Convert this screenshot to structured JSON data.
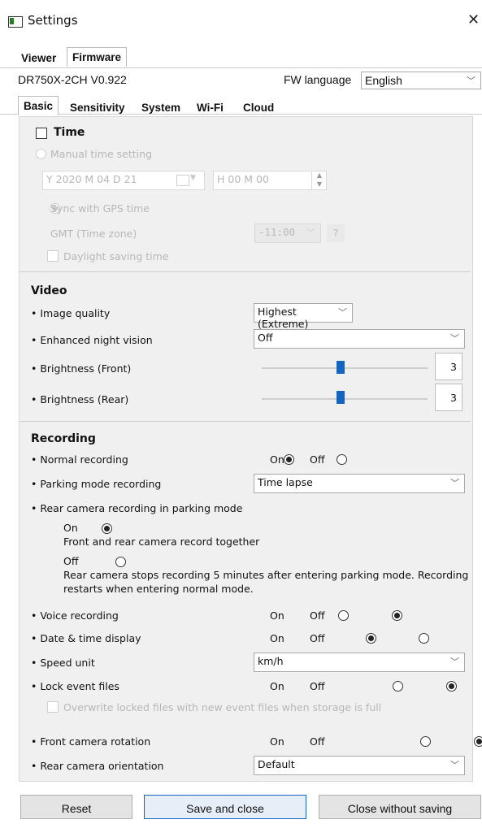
{
  "window": {
    "title": "Settings"
  },
  "top_tabs": [
    "Viewer",
    "Firmware"
  ],
  "model": "DR750X-2CH  V0.922",
  "fw_language_label": "FW language",
  "fw_language_value": "English",
  "sub_tabs": [
    "Basic",
    "Sensitivity",
    "System",
    "Wi-Fi",
    "Cloud"
  ],
  "time": {
    "title": "Time",
    "manual_label": "Manual time setting",
    "date_value": "Y 2020 M 04 D 21",
    "time_value": "H 00 M 00",
    "gps_label": "Sync with GPS time",
    "gmt_label": "GMT (Time zone)",
    "gmt_value": "-11:00",
    "gmt_help": "?",
    "dst_label": "Daylight saving time"
  },
  "video": {
    "title": "Video",
    "image_quality_label": "• Image quality",
    "image_quality_value": "Highest (Extreme)",
    "night_vision_label": "• Enhanced night vision",
    "night_vision_value": "Off",
    "brightness_front_label": "• Brightness (Front)",
    "brightness_front_value": "3",
    "brightness_rear_label": "• Brightness (Rear)",
    "brightness_rear_value": "3"
  },
  "recording": {
    "title": "Recording",
    "normal_label": "• Normal recording",
    "on": "On",
    "off": "Off",
    "parking_label": "• Parking mode recording",
    "parking_value": "Time lapse",
    "rear_parking_label": "• Rear camera recording in parking mode",
    "rear_on_desc": "Front and rear camera record together",
    "rear_off_desc_1": "Rear camera stops recording 5 minutes after entering parking mode. Recording",
    "rear_off_desc_2": "restarts when entering normal mode.",
    "voice_label": "• Voice recording",
    "datetime_label": "• Date & time display",
    "speed_label": "• Speed unit",
    "speed_value": "km/h",
    "lock_label": "• Lock event files",
    "overwrite_label": "Overwrite locked files with new event files when storage is full",
    "front_rotation_label": "• Front camera rotation",
    "rear_orientation_label": "• Rear camera orientation",
    "rear_orientation_value": "Default"
  },
  "buttons": {
    "reset": "Reset",
    "save": "Save and close",
    "close": "Close without saving"
  }
}
